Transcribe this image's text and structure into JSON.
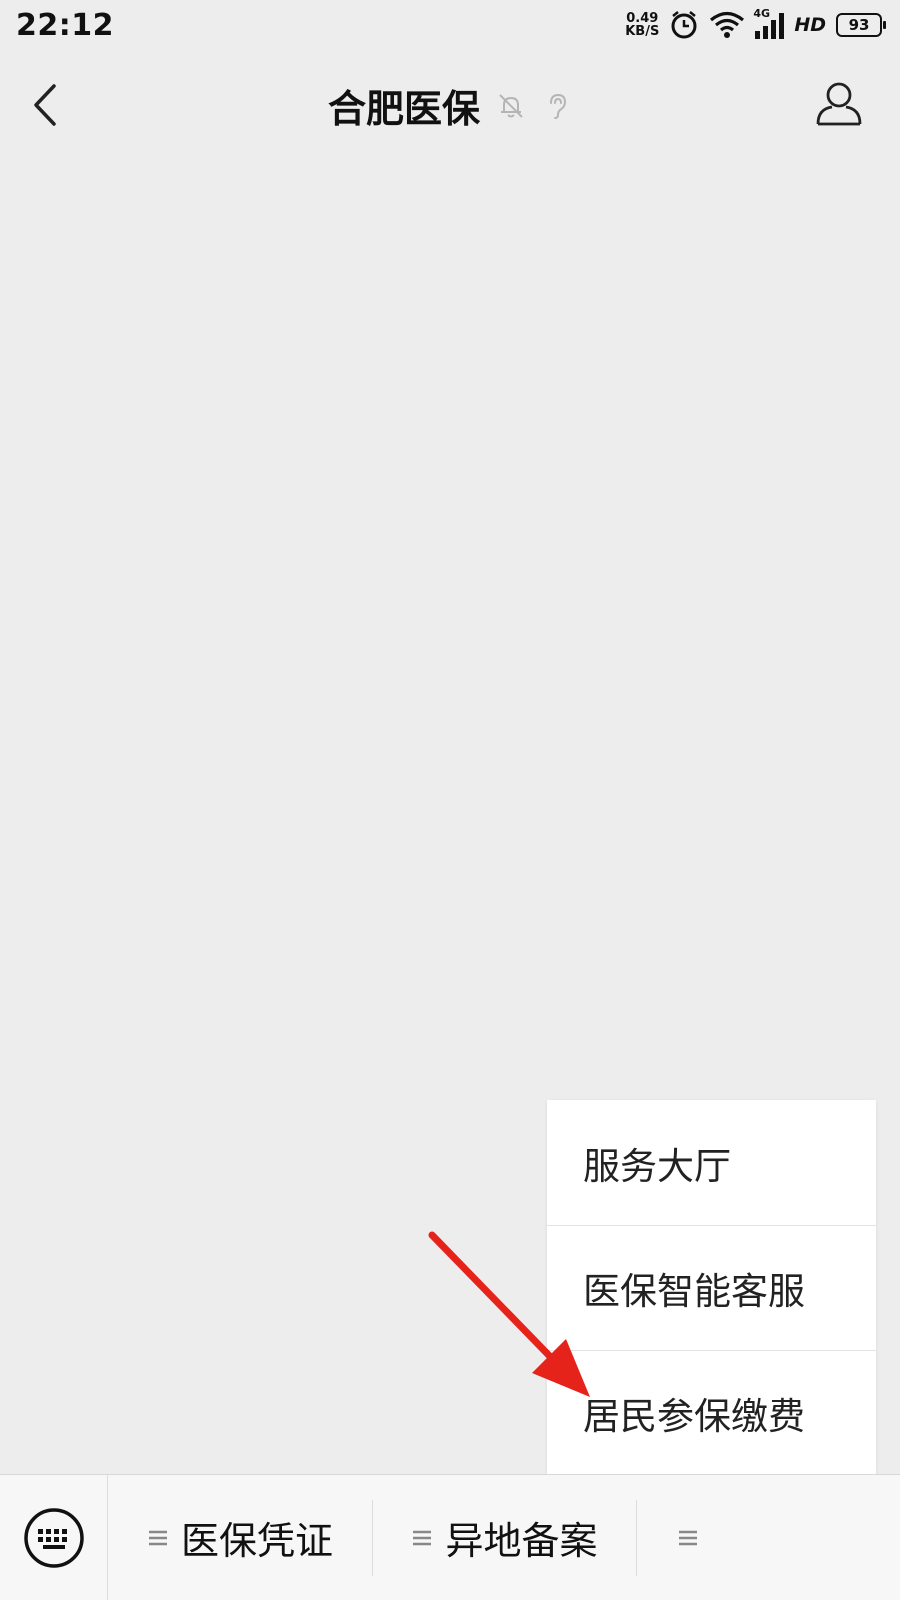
{
  "status_bar": {
    "time": "22:12",
    "net_speed_value": "0.49",
    "net_speed_unit": "KB/S",
    "network": "4G",
    "hd": "HD",
    "battery": "93"
  },
  "header": {
    "title": "合肥医保",
    "icons": [
      "back-arrow-icon",
      "mute-bell-icon",
      "ear-icon",
      "profile-icon"
    ]
  },
  "popup_menu": {
    "items": [
      {
        "label": "服务大厅"
      },
      {
        "label": "医保智能客服"
      },
      {
        "label": "居民参保缴费"
      }
    ]
  },
  "annotation": {
    "arrow_color": "#e5231b"
  },
  "bottom_menu": {
    "tabs": [
      {
        "label": "医保凭证"
      },
      {
        "label": "异地备案"
      }
    ]
  },
  "colors": {
    "background": "#ededed",
    "menu_background": "#ffffff",
    "bottom_bar": "#f7f7f7"
  }
}
